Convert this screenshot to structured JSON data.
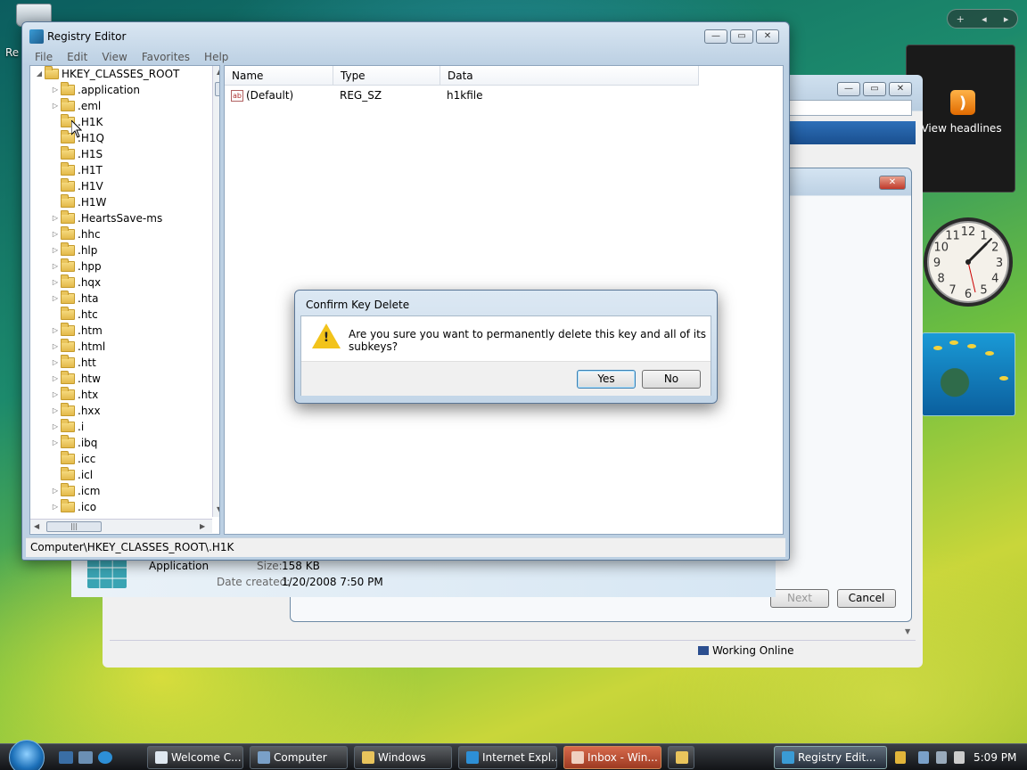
{
  "desktop": {
    "recycle_label": "Re",
    "feed_label": "View headlines",
    "sidebar_buttons": [
      "+",
      "◂",
      "▸"
    ]
  },
  "clock": {
    "numbers": [
      "12",
      "1",
      "2",
      "3",
      "4",
      "5",
      "6",
      "7",
      "8",
      "9",
      "10",
      "11"
    ]
  },
  "registry": {
    "title": "Registry Editor",
    "menu": [
      "File",
      "Edit",
      "View",
      "Favorites",
      "Help"
    ],
    "root": "HKEY_CLASSES_ROOT",
    "tree_items": [
      {
        "label": ".application",
        "expand": true
      },
      {
        "label": ".eml",
        "expand": true
      },
      {
        "label": ".H1K",
        "expand": false
      },
      {
        "label": ".H1Q",
        "expand": false
      },
      {
        "label": ".H1S",
        "expand": false
      },
      {
        "label": ".H1T",
        "expand": false
      },
      {
        "label": ".H1V",
        "expand": false
      },
      {
        "label": ".H1W",
        "expand": false
      },
      {
        "label": ".HeartsSave-ms",
        "expand": true
      },
      {
        "label": ".hhc",
        "expand": true
      },
      {
        "label": ".hlp",
        "expand": true
      },
      {
        "label": ".hpp",
        "expand": true
      },
      {
        "label": ".hqx",
        "expand": true
      },
      {
        "label": ".hta",
        "expand": true
      },
      {
        "label": ".htc",
        "expand": false
      },
      {
        "label": ".htm",
        "expand": true
      },
      {
        "label": ".html",
        "expand": true
      },
      {
        "label": ".htt",
        "expand": true
      },
      {
        "label": ".htw",
        "expand": true
      },
      {
        "label": ".htx",
        "expand": true
      },
      {
        "label": ".hxx",
        "expand": true
      },
      {
        "label": ".i",
        "expand": true
      },
      {
        "label": ".ibq",
        "expand": true
      },
      {
        "label": ".icc",
        "expand": false
      },
      {
        "label": ".icl",
        "expand": false
      },
      {
        "label": ".icm",
        "expand": true
      },
      {
        "label": ".ico",
        "expand": true
      }
    ],
    "columns": [
      "Name",
      "Type",
      "Data"
    ],
    "values": [
      {
        "name": "(Default)",
        "type": "REG_SZ",
        "data": "h1kfile"
      }
    ],
    "status": "Computer\\HKEY_CLASSES_ROOT\\.H1K"
  },
  "dialog": {
    "title": "Confirm Key Delete",
    "message": "Are you sure you want to permanently delete this key and all of its subkeys?",
    "yes_label": "Yes",
    "no_label": "No"
  },
  "background_window": {
    "app_label": "Application",
    "size_label": "Size:",
    "size_value": "158 KB",
    "date_label": "Date created:",
    "date_value": "1/20/2008 7:50 PM",
    "next_label": "Next",
    "cancel_label": "Cancel",
    "status_label": "Working Online"
  },
  "taskbar": {
    "buttons": [
      "Welcome C...",
      "Computer",
      "Windows",
      "Internet Expl...",
      "Inbox - Win...",
      "",
      "Registry Edit..."
    ],
    "time": "5:09 PM"
  }
}
